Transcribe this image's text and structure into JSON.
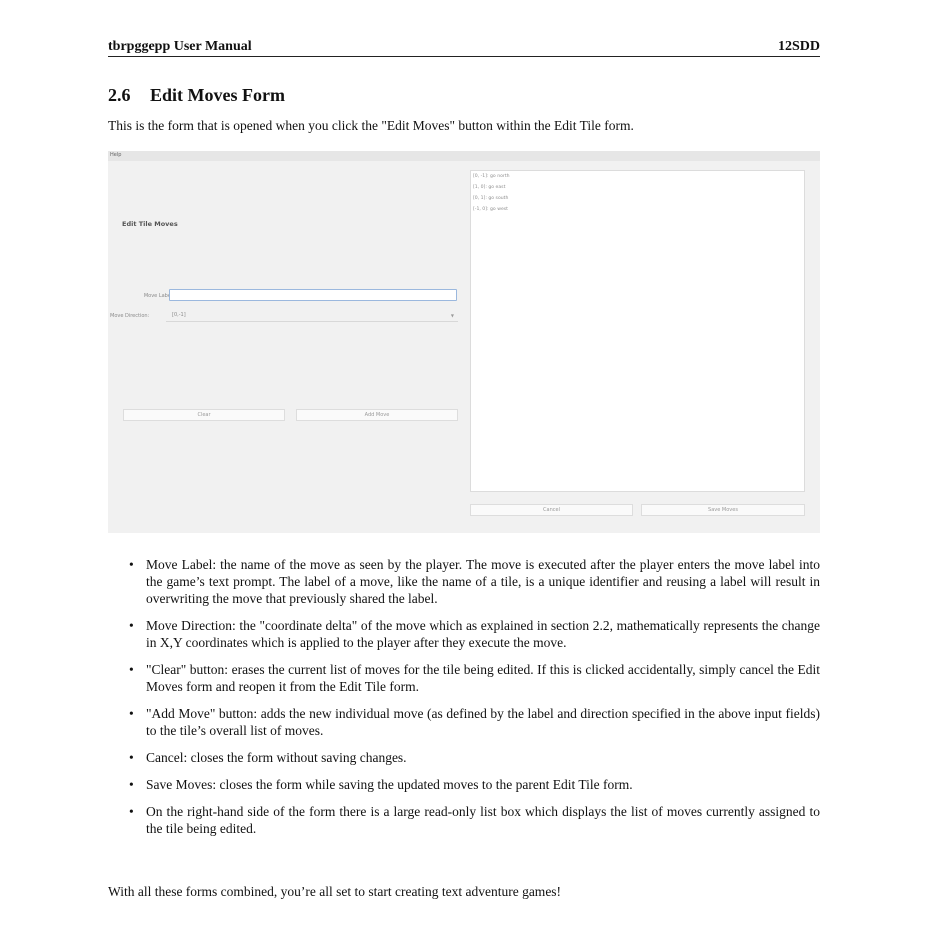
{
  "header": {
    "left": "tbrpggepp User Manual",
    "right": "12SDD"
  },
  "section": {
    "number": "2.6",
    "title": "Edit Moves Form"
  },
  "intro": "This is the form that is opened when you click the \"Edit Moves\" button within the Edit Tile form.",
  "screenshot": {
    "menu_help": "Help",
    "form_title": "Edit Tile Moves",
    "move_label": "Move Label:",
    "move_label_value": "",
    "move_direction": "Move Direction:",
    "move_direction_value": "[0,-1]",
    "clear_button": "Clear",
    "add_move_button": "Add Move",
    "cancel_button": "Cancel",
    "save_moves_button": "Save Moves",
    "moves_list": [
      "[0, -1]: go north",
      "[1, 0]: go east",
      "[0, 1]: go south",
      "[-1, 0]: go west"
    ],
    "icons": {
      "dropdown": "chevron-down-icon"
    }
  },
  "bullets": [
    "Move Label: the name of the move as seen by the player. The move is executed after the player enters the move label into the game’s text prompt. The label of a move, like the name of a tile, is a unique identifier and reusing a label will result in overwriting the move that previously shared the label.",
    "Move Direction: the \"coordinate delta\" of the move which as explained in section 2.2, mathematically represents the change in X,Y coordinates which is applied to the player after they execute the move.",
    "\"Clear\" button: erases the current list of moves for the tile being edited.  If this is clicked accidentally, simply cancel the Edit Moves form and reopen it from the Edit Tile form.",
    "\"Add Move\" button: adds the new individual move (as defined by the label and direction specified in the above input fields) to the tile’s overall list of moves.",
    "Cancel: closes the form without saving changes.",
    "Save Moves: closes the form while saving the updated moves to the parent Edit Tile form.",
    "On the right-hand side of the form there is a large read-only list box which displays the list of moves currently assigned to the tile being edited."
  ],
  "outro": "With all these forms combined, you’re all set to start creating text adventure games!"
}
